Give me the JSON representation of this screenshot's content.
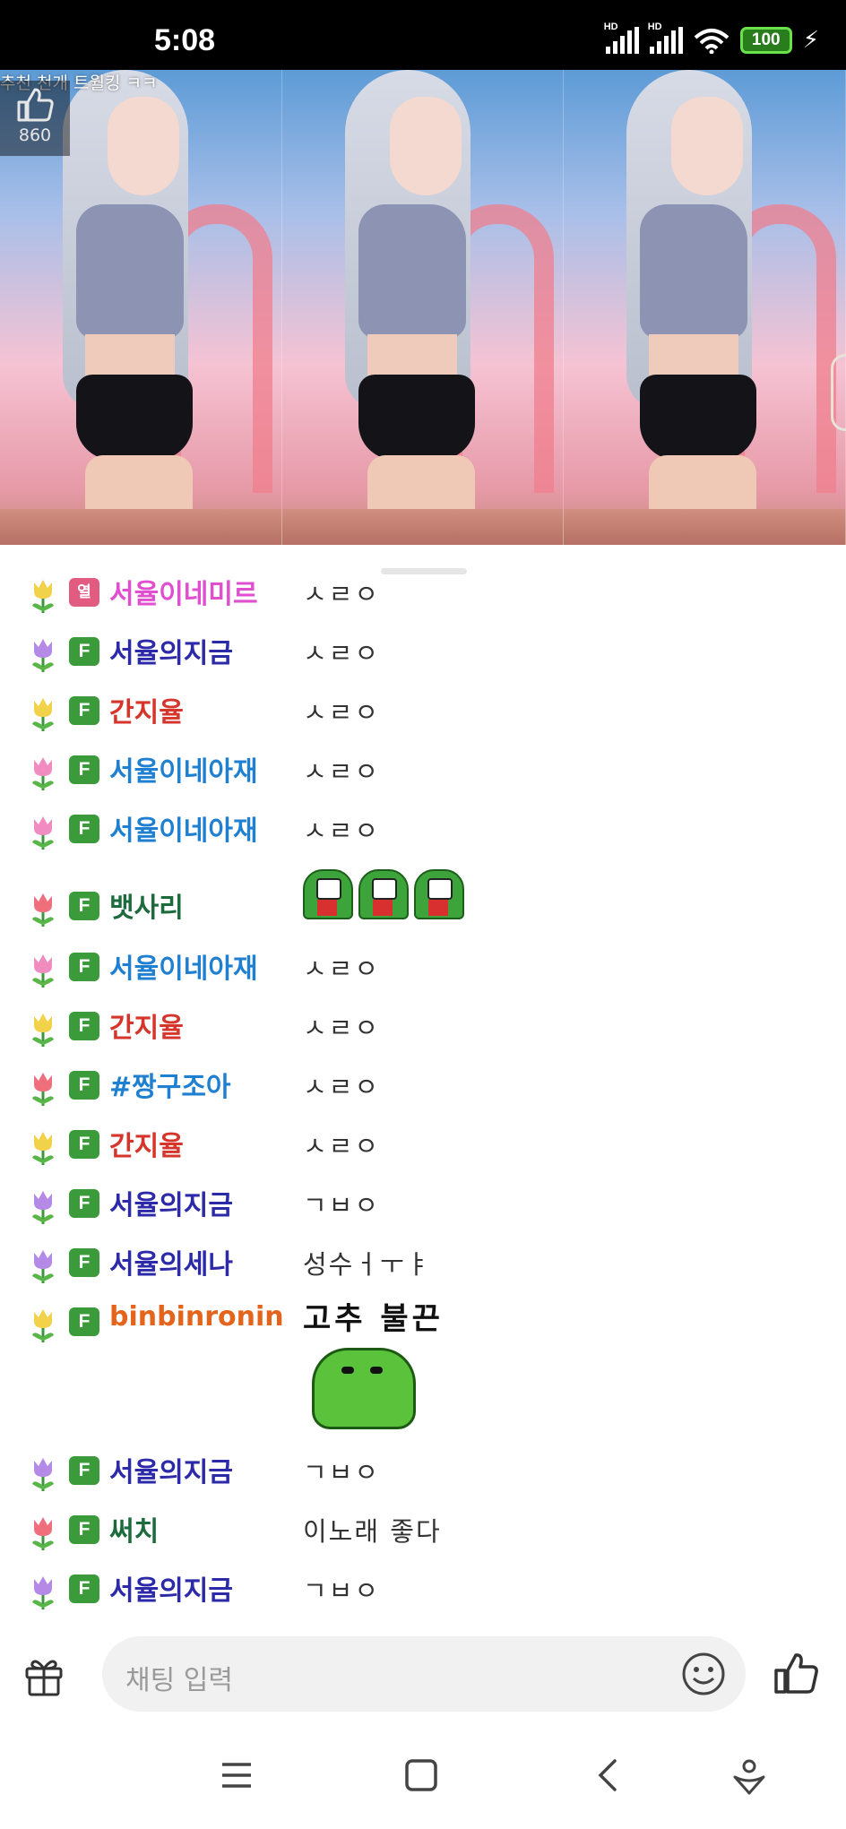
{
  "status_bar": {
    "time": "5:08",
    "network_1": "HD",
    "network_2": "HD",
    "battery": "100",
    "icons": [
      "signal-icon",
      "signal-icon",
      "wifi-icon",
      "battery-icon",
      "charging-icon"
    ]
  },
  "video": {
    "caption": "추천 천개 트월킹 ㅋㅋ",
    "like_count": "860"
  },
  "chat": {
    "messages": [
      {
        "badge": "열",
        "nick": "서율이네미르",
        "nick_color": "#e04fd0",
        "flower": "yellow",
        "text": "ㅅㄹㅇ"
      },
      {
        "badge": "F",
        "nick": "서율의지금",
        "nick_color": "#2c2aa8",
        "flower": "purple",
        "text": "ㅅㄹㅇ"
      },
      {
        "badge": "F",
        "nick": "간지율",
        "nick_color": "#d6352c",
        "flower": "yellow",
        "text": "ㅅㄹㅇ"
      },
      {
        "badge": "F",
        "nick": "서율이네아재",
        "nick_color": "#1f7fd0",
        "flower": "pink",
        "text": "ㅅㄹㅇ"
      },
      {
        "badge": "F",
        "nick": "서율이네아재",
        "nick_color": "#1f7fd0",
        "flower": "pink",
        "text": "ㅅㄹㅇ"
      },
      {
        "badge": "F",
        "nick": "뱃사리",
        "nick_color": "#1d6b3c",
        "flower": "red",
        "text": ""
      },
      {
        "badge": "F",
        "nick": "서율이네아재",
        "nick_color": "#1f7fd0",
        "flower": "pink",
        "text": "ㅅㄹㅇ"
      },
      {
        "badge": "F",
        "nick": "간지율",
        "nick_color": "#d6352c",
        "flower": "yellow",
        "text": "ㅅㄹㅇ"
      },
      {
        "badge": "F",
        "nick": "#짱구조아",
        "nick_color": "#1f7fd0",
        "flower": "red",
        "text": "ㅅㄹㅇ"
      },
      {
        "badge": "F",
        "nick": "간지율",
        "nick_color": "#d6352c",
        "flower": "yellow",
        "text": "ㅅㄹㅇ"
      },
      {
        "badge": "F",
        "nick": "서율의지금",
        "nick_color": "#2c2aa8",
        "flower": "purple",
        "text": "ㄱㅂㅇ"
      },
      {
        "badge": "F",
        "nick": "서율의세나",
        "nick_color": "#2c2aa8",
        "flower": "purple",
        "text": "성수ㅓㅜㅑ"
      },
      {
        "badge": "F",
        "nick": "binbinronin",
        "nick_color": "#e5641c",
        "flower": "yellow",
        "text": ""
      },
      {
        "badge": "F",
        "nick": "서율의지금",
        "nick_color": "#2c2aa8",
        "flower": "purple",
        "text": "ㄱㅂㅇ"
      },
      {
        "badge": "F",
        "nick": "써치",
        "nick_color": "#1d6b3c",
        "flower": "red",
        "text": "이노래 좋다"
      },
      {
        "badge": "F",
        "nick": "서율의지금",
        "nick_color": "#2c2aa8",
        "flower": "purple",
        "text": "ㄱㅂㅇ"
      }
    ],
    "sticker_text": "고추 불끈"
  },
  "input": {
    "placeholder": "채팅 입력",
    "icons": [
      "gift-icon",
      "emoji-icon",
      "thumbs-up-icon"
    ]
  },
  "nav": {
    "icons": [
      "menu-icon",
      "home-icon",
      "back-icon",
      "assistant-icon"
    ]
  },
  "colors": {
    "flower_yellow": "#f2d24a",
    "flower_purple": "#b48ae6",
    "flower_pink": "#f08cc0",
    "flower_red": "#ef6f7c",
    "badge_green": "#3b9b3b",
    "badge_pink": "#e15c80"
  }
}
